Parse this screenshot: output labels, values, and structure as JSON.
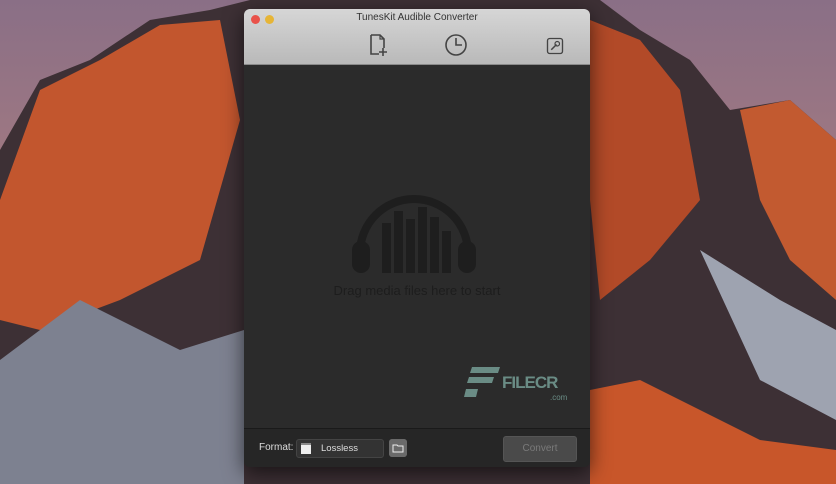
{
  "window": {
    "title": "TunesKit Audible Converter"
  },
  "toolbar": {
    "items": [
      {
        "icon": "add-file-icon"
      },
      {
        "icon": "history-icon"
      },
      {
        "icon": "wrench-settings-icon"
      }
    ]
  },
  "drop_area": {
    "hint": "Drag media files here to start",
    "icon": "headphones-icon"
  },
  "watermark": {
    "text": "FILECR",
    ".com": ".com"
  },
  "bottom": {
    "format_label": "Format:",
    "format_value": "Lossless",
    "convert_label": "Convert"
  },
  "colors": {
    "titlebar": "#c8c8c8",
    "content": "#2b2b2b",
    "watermark": "#6a8c85"
  }
}
